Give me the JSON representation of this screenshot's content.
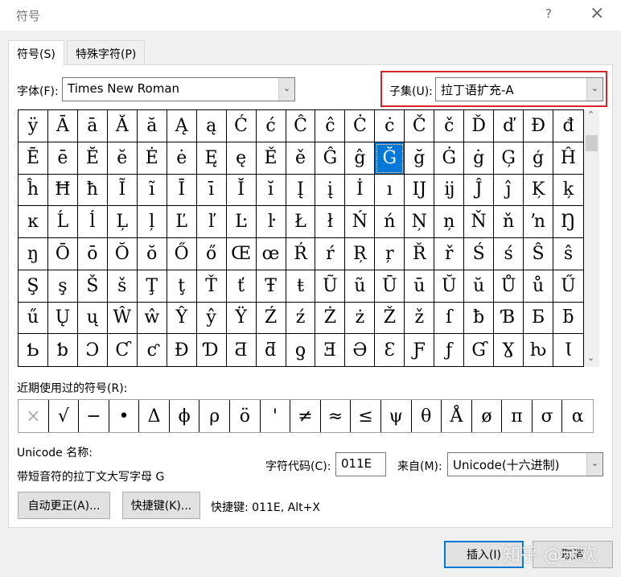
{
  "window": {
    "title": "符号",
    "help": "?",
    "close": "×"
  },
  "tabs": [
    {
      "label": "符号(S)"
    },
    {
      "label": "特殊字符(P)"
    }
  ],
  "font": {
    "label": "字体(F):",
    "value": "Times New Roman"
  },
  "subset": {
    "label": "子集(U):",
    "value": "拉丁语扩充-A",
    "highlight_color": "#d9232a"
  },
  "grid": {
    "selected_index": 31,
    "chars": [
      "ÿ",
      "Ā",
      "ā",
      "Ă",
      "ă",
      "Ą",
      "ą",
      "Ć",
      "ć",
      "Ĉ",
      "ĉ",
      "Ċ",
      "ċ",
      "Č",
      "č",
      "Ď",
      "ď",
      "Đ",
      "đ",
      "Ē",
      "ē",
      "Ĕ",
      "ĕ",
      "Ė",
      "ė",
      "Ę",
      "ę",
      "Ě",
      "ě",
      "Ĝ",
      "ĝ",
      "Ğ",
      "ğ",
      "Ġ",
      "ġ",
      "Ģ",
      "ģ",
      "Ĥ",
      "ĥ",
      "Ħ",
      "ħ",
      "Ĩ",
      "ĩ",
      "Ī",
      "ī",
      "Ĭ",
      "ĭ",
      "Į",
      "į",
      "İ",
      "ı",
      "Ĳ",
      "ĳ",
      "Ĵ",
      "ĵ",
      "Ķ",
      "ķ",
      "ĸ",
      "Ĺ",
      "ĺ",
      "Ļ",
      "ļ",
      "Ľ",
      "ľ",
      "Ŀ",
      "ŀ",
      "Ł",
      "ł",
      "Ń",
      "ń",
      "Ņ",
      "ņ",
      "Ň",
      "ň",
      "ŉ",
      "Ŋ",
      "ŋ",
      "Ō",
      "ō",
      "Ŏ",
      "ŏ",
      "Ő",
      "ő",
      "Œ",
      "œ",
      "Ŕ",
      "ŕ",
      "Ŗ",
      "ŗ",
      "Ř",
      "ř",
      "Ś",
      "ś",
      "Ŝ",
      "ŝ",
      "Ş",
      "ş",
      "Š",
      "š",
      "Ţ",
      "ţ",
      "Ť",
      "ť",
      "Ŧ",
      "ŧ",
      "Ũ",
      "ũ",
      "Ū",
      "ū",
      "Ŭ",
      "ŭ",
      "Ů",
      "ů",
      "Ű",
      "ű",
      "Ų",
      "ų",
      "Ŵ",
      "ŵ",
      "Ŷ",
      "ŷ",
      "Ÿ",
      "Ź",
      "ź",
      "Ż",
      "ż",
      "Ž",
      "ž",
      "ſ",
      "ƀ",
      "Ɓ",
      "Ƃ",
      "ƃ",
      "Ƅ",
      "ƅ",
      "Ɔ",
      "Ƈ",
      "ƈ",
      "Ɖ",
      "Ɗ",
      "Ƌ",
      "ƌ",
      "ƍ",
      "Ǝ",
      "Ə",
      "Ɛ",
      "Ƒ",
      "ƒ",
      "Ɠ",
      "Ɣ",
      "ƕ",
      "Ɩ"
    ]
  },
  "recent": {
    "label": "近期使用过的符号(R):",
    "chars": [
      "×",
      "√",
      "−",
      "•",
      "Δ",
      "ϕ",
      "ρ",
      "ö",
      "'",
      "≠",
      "≈",
      "≤",
      "ψ",
      "θ",
      "Å",
      "ø",
      "π",
      "σ",
      "α"
    ]
  },
  "unicode_name": {
    "label": "Unicode 名称:",
    "value": "带短音符的拉丁文大写字母 G"
  },
  "char_code": {
    "label": "字符代码(C):",
    "value": "011E"
  },
  "from": {
    "label": "来自(M):",
    "value": "Unicode(十六进制)"
  },
  "buttons": {
    "autocorrect": "自动更正(A)...",
    "shortcut_key": "快捷键(K)...",
    "insert": "插入(I)",
    "cancel": "取消"
  },
  "shortcut_text": "快捷键: 011E, Alt+X",
  "watermark": "知乎 @示欢"
}
